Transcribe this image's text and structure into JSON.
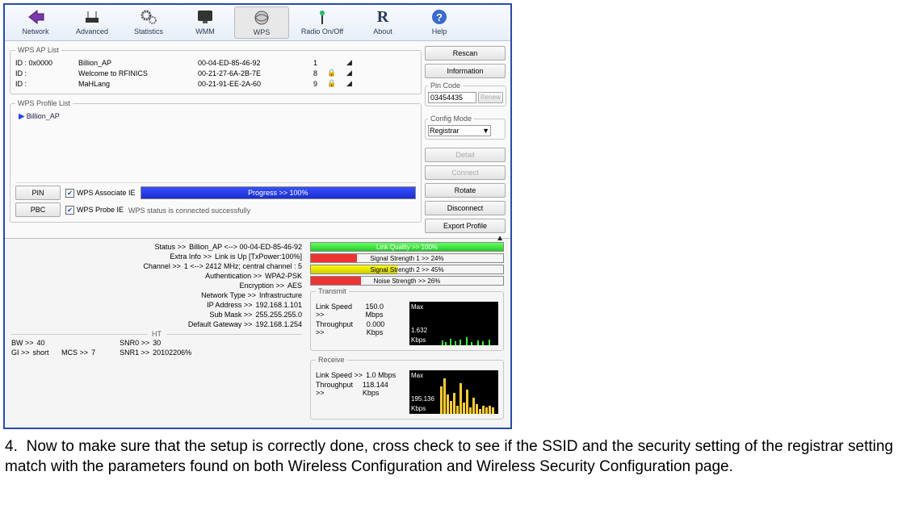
{
  "toolbar": {
    "network": "Network",
    "advanced": "Advanced",
    "statistics": "Statistics",
    "wmm": "WMM",
    "wps": "WPS",
    "radio": "Radio On/Off",
    "about": "About",
    "help": "Help"
  },
  "groups": {
    "ap_list": "WPS AP List",
    "profile_list": "WPS Profile List",
    "pin_code": "Pin Code",
    "config_mode": "Config Mode",
    "ht": "HT",
    "transmit": "Transmit",
    "receive": "Receive"
  },
  "ap": [
    {
      "id": "ID : 0x0000",
      "ssid": "Billion_AP",
      "mac": "00-04-ED-85-46-92",
      "ch": "1",
      "lock": ""
    },
    {
      "id": "ID :",
      "ssid": "Welcome to RFINICS",
      "mac": "00-21-27-6A-2B-7E",
      "ch": "8",
      "lock": "🔒"
    },
    {
      "id": "ID :",
      "ssid": "MaHLang",
      "mac": "00-21-91-EE-2A-60",
      "ch": "9",
      "lock": "🔒"
    }
  ],
  "profile": {
    "item": "Billion_AP"
  },
  "side": {
    "rescan": "Rescan",
    "information": "Information",
    "renew": "Renew",
    "pin_value": "03454435",
    "config_value": "Registrar",
    "detail": "Detail",
    "connect": "Connect",
    "rotate": "Rotate",
    "disconnect": "Disconnect",
    "export": "Export Profile"
  },
  "actions": {
    "pin": "PIN",
    "pbc": "PBC",
    "wps_assoc_ie": "WPS Associate IE",
    "wps_probe_ie": "WPS Probe IE",
    "progress": "Progress >> 100%",
    "status_msg": "WPS status is connected successfully"
  },
  "stats": {
    "status_l": "Status >>",
    "status_v": "Billion_AP <--> 00-04-ED-85-46-92",
    "extra_l": "Extra Info >>",
    "extra_v": "Link is Up [TxPower:100%]",
    "channel_l": "Channel >>",
    "channel_v": "1 <--> 2412 MHz; central channel : 5",
    "auth_l": "Authentication >>",
    "auth_v": "WPA2-PSK",
    "enc_l": "Encryption >>",
    "enc_v": "AES",
    "net_l": "Network Type >>",
    "net_v": "Infrastructure",
    "ip_l": "IP Address >>",
    "ip_v": "192.168.1.101",
    "mask_l": "Sub Mask >>",
    "mask_v": "255.255.255.0",
    "gw_l": "Default Gateway >>",
    "gw_v": "192.168.1.254"
  },
  "bars": {
    "link_quality": "Link Quality >> 100%",
    "sig1": "Signal Strength 1 >> 24%",
    "sig2": "Signal Strength 2 >> 45%",
    "noise": "Noise Strength >> 26%"
  },
  "ht": {
    "bw_l": "BW >>",
    "bw_v": "40",
    "gi_l": "GI >>",
    "gi_v": "short",
    "mcs_l": "MCS >>",
    "mcs_v": "7",
    "snr0_l": "SNR0 >>",
    "snr0_v": "30",
    "snr1_l": "SNR1 >>",
    "snr1_v": "20102206%"
  },
  "tx": {
    "link_l": "Link Speed >>",
    "link_v": "150.0 Mbps",
    "thr_l": "Throughput >>",
    "thr_v": "0.000 Kbps",
    "gmax": "Max",
    "gval": "1.632",
    "gunit": "Kbps"
  },
  "rx": {
    "link_l": "Link Speed >>",
    "link_v": "1.0 Mbps",
    "thr_l": "Throughput >>",
    "thr_v": "118.144 Kbps",
    "gmax": "Max",
    "gval": "195.136",
    "gunit": "Kbps"
  },
  "instruction": {
    "num": "4.",
    "text": "Now to make sure that the setup is correctly done, cross check to see if the SSID and the security setting of the registrar setting match with the parameters found on both Wireless Configuration and Wireless Security Configuration page."
  }
}
